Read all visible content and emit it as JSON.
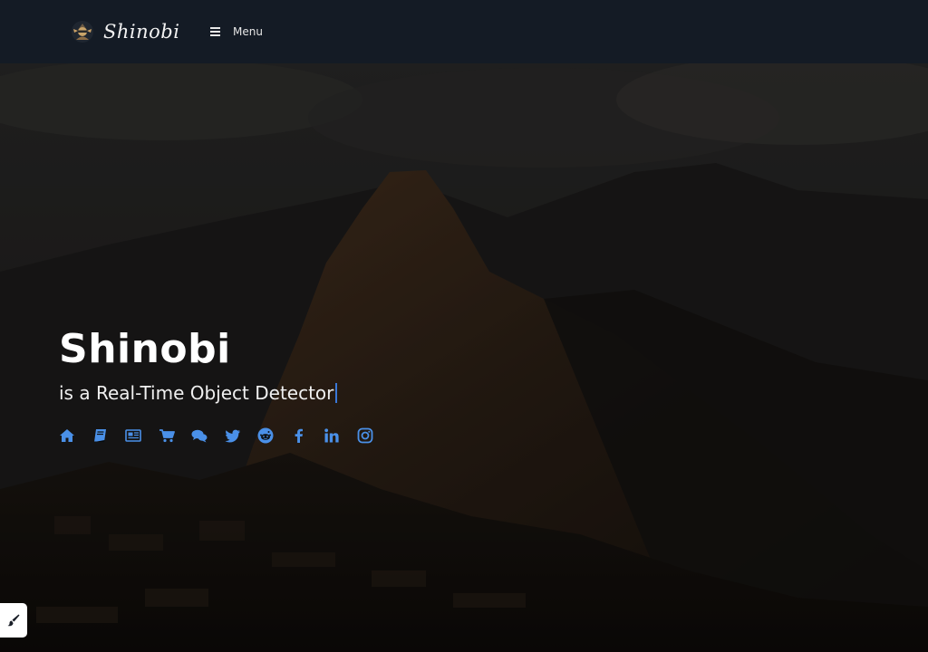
{
  "header": {
    "brand_name": "Shinobi",
    "menu_label": "Menu"
  },
  "hero": {
    "title": "Shinobi",
    "subtitle": "is a Real-Time Object Detector",
    "background_icon": "mountain-landscape"
  },
  "social_links": [
    {
      "icon": "home-icon"
    },
    {
      "icon": "book-icon"
    },
    {
      "icon": "newspaper-icon"
    },
    {
      "icon": "shopping-cart-icon"
    },
    {
      "icon": "chat-icon"
    },
    {
      "icon": "twitter-icon"
    },
    {
      "icon": "reddit-icon"
    },
    {
      "icon": "facebook-icon"
    },
    {
      "icon": "linkedin-icon"
    },
    {
      "icon": "instagram-icon"
    }
  ],
  "colors": {
    "header_bg": "#141b25",
    "accent": "#4a90e8",
    "cursor": "#3a78d8"
  },
  "customizer": {
    "icon": "paintbrush-icon"
  }
}
